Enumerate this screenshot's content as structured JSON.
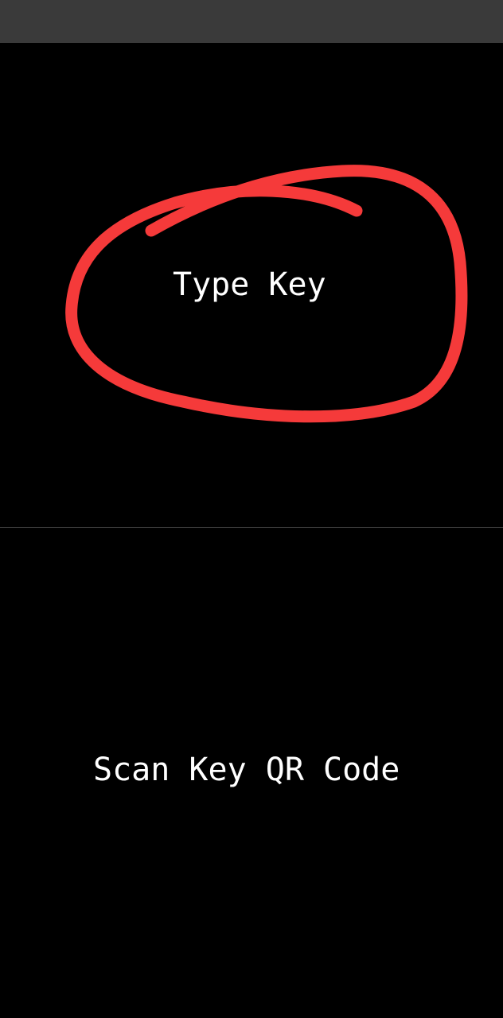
{
  "options": {
    "type_key": {
      "label": "Type Key"
    },
    "scan_qr": {
      "label": "Scan Key QR Code"
    }
  },
  "colors": {
    "background": "#000000",
    "top_bar": "#3a3a3a",
    "divider": "#4a4a4a",
    "label_text": "#ffffff",
    "annotation": "#f53a3a"
  }
}
